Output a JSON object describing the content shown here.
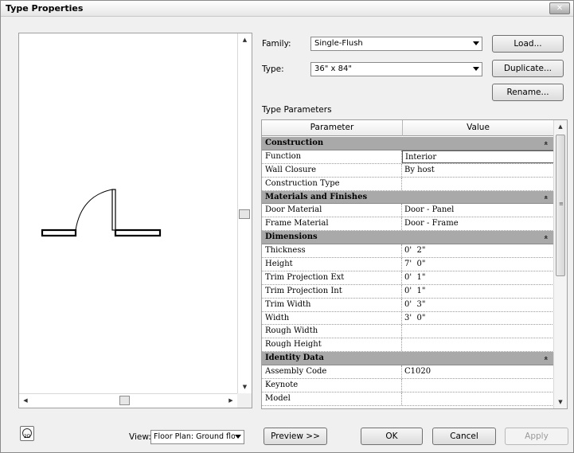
{
  "window": {
    "title": "Type Properties",
    "close_label": "✕"
  },
  "family": {
    "label": "Family:",
    "value": "Single-Flush"
  },
  "type": {
    "label": "Type:",
    "value": "36\" x 84\""
  },
  "buttons": {
    "load": "Load...",
    "duplicate": "Duplicate...",
    "rename": "Rename...",
    "preview": "Preview >>",
    "ok": "OK",
    "cancel": "Cancel",
    "apply": "Apply"
  },
  "type_parameters_label": "Type Parameters",
  "grid": {
    "headers": [
      "Parameter",
      "Value"
    ],
    "groups": [
      {
        "name": "Construction",
        "rows": [
          {
            "param": "Function",
            "value": "Interior",
            "selected": true
          },
          {
            "param": "Wall Closure",
            "value": "By host"
          },
          {
            "param": "Construction Type",
            "value": ""
          }
        ]
      },
      {
        "name": "Materials and Finishes",
        "rows": [
          {
            "param": "Door Material",
            "value": "Door - Panel"
          },
          {
            "param": "Frame Material",
            "value": "Door - Frame"
          }
        ]
      },
      {
        "name": "Dimensions",
        "rows": [
          {
            "param": "Thickness",
            "value": "0'  2\""
          },
          {
            "param": "Height",
            "value": "7'  0\""
          },
          {
            "param": "Trim Projection Ext",
            "value": "0'  1\""
          },
          {
            "param": "Trim Projection Int",
            "value": "0'  1\""
          },
          {
            "param": "Trim Width",
            "value": "0'  3\""
          },
          {
            "param": "Width",
            "value": "3'  0\""
          },
          {
            "param": "Rough Width",
            "value": ""
          },
          {
            "param": "Rough Height",
            "value": ""
          }
        ]
      },
      {
        "name": "Identity Data",
        "rows": [
          {
            "param": "Assembly Code",
            "value": "C1020"
          },
          {
            "param": "Keynote",
            "value": ""
          },
          {
            "param": "Model",
            "value": ""
          }
        ]
      }
    ]
  },
  "view": {
    "label": "View:",
    "value": "Floor Plan: Ground flo"
  },
  "icons": {
    "collapse_group": "collapse-chevron-icon",
    "view_2d": "2d-view-icon"
  }
}
